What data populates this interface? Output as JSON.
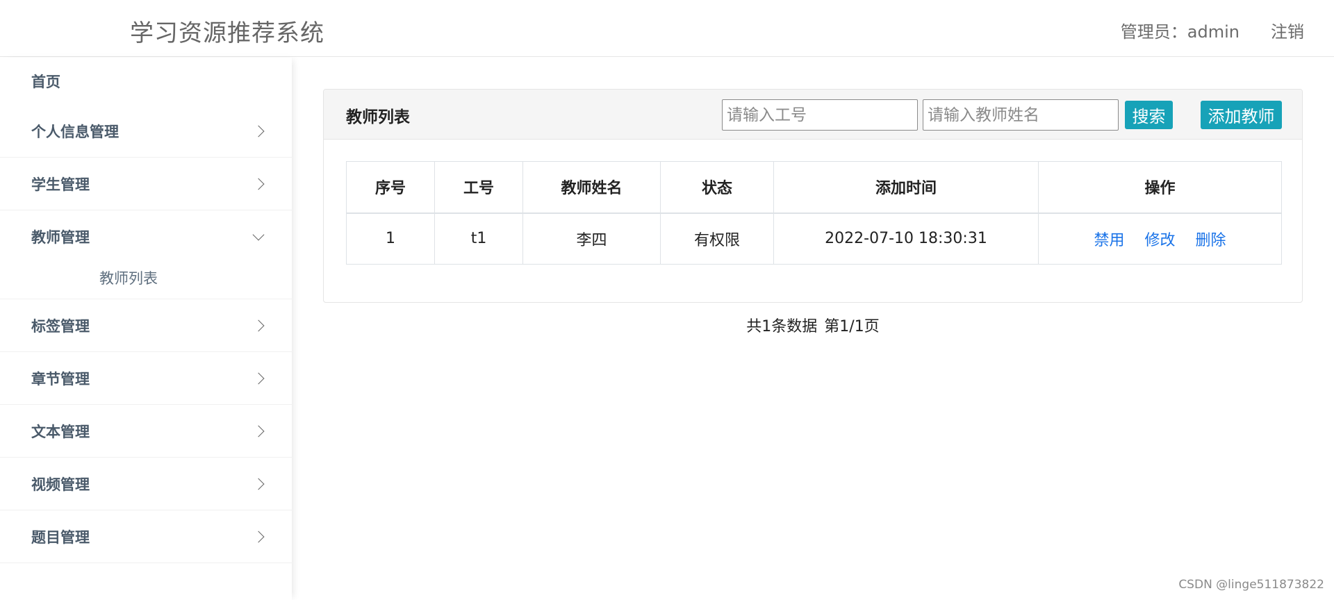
{
  "header": {
    "title": "学习资源推荐系统",
    "admin": "管理员：admin",
    "logout": "注销"
  },
  "sidebar": {
    "items": [
      {
        "label": "首页"
      },
      {
        "label": "个人信息管理"
      },
      {
        "label": "学生管理"
      },
      {
        "label": "教师管理",
        "submenu": [
          "教师列表"
        ]
      },
      {
        "label": "标签管理"
      },
      {
        "label": "章节管理"
      },
      {
        "label": "文本管理"
      },
      {
        "label": "视频管理"
      },
      {
        "label": "题目管理"
      }
    ]
  },
  "panel": {
    "title": "教师列表",
    "id_placeholder": "请输入工号",
    "name_placeholder": "请输入教师姓名",
    "search_label": "搜索",
    "add_label": "添加教师"
  },
  "table": {
    "headers": [
      "序号",
      "工号",
      "教师姓名",
      "状态",
      "添加时间",
      "操作"
    ],
    "rows": [
      {
        "index": "1",
        "id": "t1",
        "name": "李四",
        "status": "有权限",
        "added": "2022-07-10 18:30:31"
      }
    ],
    "actions": [
      "禁用",
      "修改",
      "删除"
    ]
  },
  "pager": {
    "total": "共1条数据",
    "page": "第1/1页"
  },
  "watermark": "CSDN @linge511873822",
  "colors": {
    "accent": "#17a2b8",
    "link": "#1a73e8"
  }
}
